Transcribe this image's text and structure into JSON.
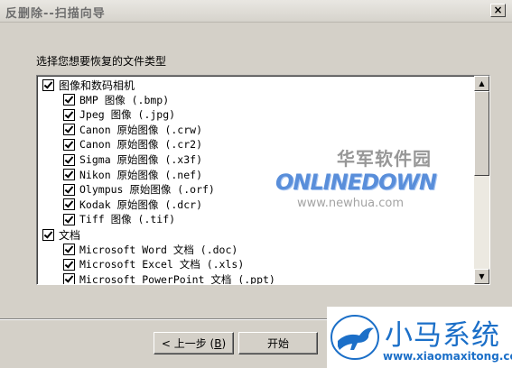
{
  "window": {
    "title": "反删除--扫描向导",
    "close_glyph": "×"
  },
  "section_label": "选择您想要恢复的文件类型",
  "file_types": [
    {
      "label": "图像和数码相机",
      "level": 0,
      "checked": true
    },
    {
      "label": "BMP 图像 (.bmp)",
      "level": 1,
      "checked": true
    },
    {
      "label": "Jpeg 图像 (.jpg)",
      "level": 1,
      "checked": true
    },
    {
      "label": "Canon 原始图像 (.crw)",
      "level": 1,
      "checked": true
    },
    {
      "label": "Canon 原始图像 (.cr2)",
      "level": 1,
      "checked": true
    },
    {
      "label": "Sigma 原始图像 (.x3f)",
      "level": 1,
      "checked": true
    },
    {
      "label": "Nikon 原始图像 (.nef)",
      "level": 1,
      "checked": true
    },
    {
      "label": "Olympus 原始图像 (.orf)",
      "level": 1,
      "checked": true
    },
    {
      "label": "Kodak 原始图像 (.dcr)",
      "level": 1,
      "checked": true
    },
    {
      "label": "Tiff 图像 (.tif)",
      "level": 1,
      "checked": true
    },
    {
      "label": "文档",
      "level": 0,
      "checked": true
    },
    {
      "label": "Microsoft Word 文档 (.doc)",
      "level": 1,
      "checked": true
    },
    {
      "label": "Microsoft Excel 文档 (.xls)",
      "level": 1,
      "checked": true
    },
    {
      "label": "Microsoft PowerPoint 文档 (.ppt)",
      "level": 1,
      "checked": true
    }
  ],
  "scrollbar": {
    "up_glyph": "▲",
    "down_glyph": "▼"
  },
  "buttons": {
    "back_prefix": "< 上一步 (",
    "back_key": "B",
    "back_suffix": ")",
    "start": "开始"
  },
  "watermarks": {
    "onlinedown_cn": "华军软件园",
    "onlinedown_en": "ONLINEDOWN",
    "onlinedown_url": "www.newhua.com",
    "xiaoma_cn": "小马系统",
    "xiaoma_url": "www.xiaomaxitong.com"
  }
}
